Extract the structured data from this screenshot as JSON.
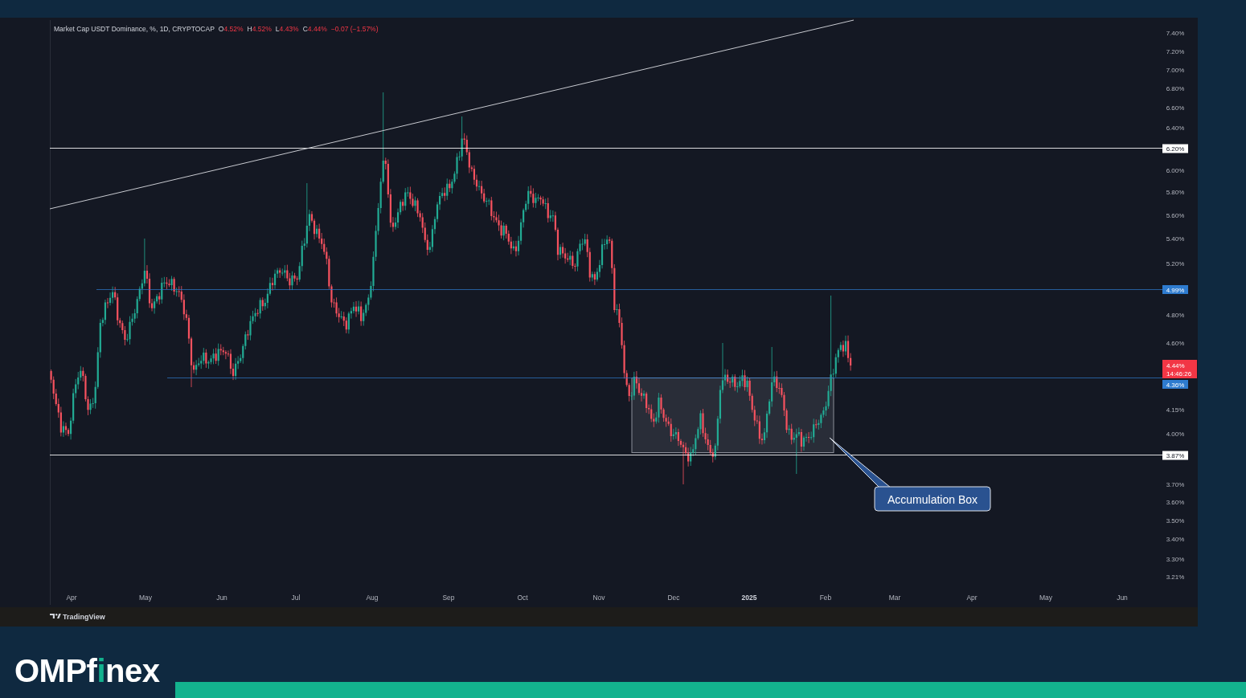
{
  "legend": {
    "title": "Market Cap USDT Dominance, %, 1D, CRYPTOCAP",
    "falling": true,
    "ohlc": [
      {
        "key": "O",
        "value": "4.52%"
      },
      {
        "key": "H",
        "value": "4.52%"
      },
      {
        "key": "L",
        "value": "4.43%"
      },
      {
        "key": "C",
        "value": "4.44%"
      }
    ],
    "change": "−0.07 (−1.57%)"
  },
  "y_axis": {
    "labels": [
      "7.40%",
      "7.20%",
      "7.00%",
      "6.80%",
      "6.60%",
      "6.40%",
      "6.00%",
      "5.80%",
      "5.60%",
      "5.40%",
      "5.20%",
      "4.80%",
      "4.60%",
      "4.15%",
      "4.00%",
      "3.70%",
      "3.60%",
      "3.50%",
      "3.40%",
      "3.30%",
      "3.21%"
    ]
  },
  "price_levels": [
    {
      "label": "6.20%",
      "color": "#ffffff"
    },
    {
      "label": "4.99%",
      "color": "#2e7bcf"
    },
    {
      "label": "4.36%",
      "color": "#2e7bcf"
    },
    {
      "label": "3.87%",
      "color": "#ffffff"
    }
  ],
  "price_tag": {
    "price": "4.44%",
    "countdown": "14:46:26",
    "falling": true
  },
  "annotation": {
    "text": "Accumulation Box"
  },
  "x_axis": {
    "labels": [
      {
        "text": "Apr",
        "kind": "month"
      },
      {
        "text": "May",
        "kind": "month"
      },
      {
        "text": "Jun",
        "kind": "month"
      },
      {
        "text": "Jul",
        "kind": "month"
      },
      {
        "text": "Aug",
        "kind": "month"
      },
      {
        "text": "Sep",
        "kind": "month"
      },
      {
        "text": "Oct",
        "kind": "month"
      },
      {
        "text": "Nov",
        "kind": "month"
      },
      {
        "text": "Dec",
        "kind": "month"
      },
      {
        "text": "2025",
        "kind": "year"
      },
      {
        "text": "Feb",
        "kind": "month"
      },
      {
        "text": "Mar",
        "kind": "month"
      },
      {
        "text": "Apr",
        "kind": "month"
      },
      {
        "text": "May",
        "kind": "month"
      },
      {
        "text": "Jun",
        "kind": "month"
      }
    ]
  },
  "attribution": {
    "text": "TradingView"
  },
  "brand": {
    "parts": [
      {
        "text": "OMPf",
        "accent": false
      },
      {
        "text": "i",
        "accent": true
      },
      {
        "text": "nex",
        "accent": false
      }
    ]
  }
}
